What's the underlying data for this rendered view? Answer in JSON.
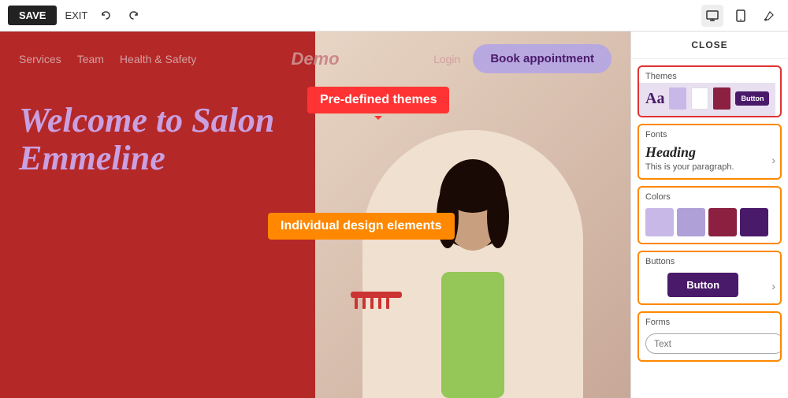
{
  "toolbar": {
    "save_label": "SAVE",
    "exit_label": "EXIT",
    "close_label": "CLOSE"
  },
  "preview": {
    "nav": {
      "links": [
        "Services",
        "Team",
        "Health & Safety"
      ],
      "logo": "Demo",
      "login": "Login",
      "book_btn": "Book appointment"
    },
    "hero_title": "Welcome to Salon Emmeline",
    "tooltip_themes": "Pre-defined themes",
    "tooltip_design": "Individual design elements"
  },
  "right_panel": {
    "close": "CLOSE",
    "sections": [
      {
        "id": "themes",
        "label": "Themes",
        "aa_text": "Aa",
        "btn_preview": "Button",
        "swatches": [
          "#c8b8e8",
          "#fff",
          "#8b2040"
        ]
      },
      {
        "id": "fonts",
        "label": "Fonts",
        "heading": "Heading",
        "paragraph": "This is your paragraph."
      },
      {
        "id": "colors",
        "label": "Colors",
        "swatches": [
          "#c8b8e8",
          "#b0a0d8",
          "#8b2040",
          "#4a1a6a"
        ]
      },
      {
        "id": "buttons",
        "label": "Buttons",
        "btn_label": "Button"
      },
      {
        "id": "forms",
        "label": "Forms",
        "input_placeholder": "Text"
      }
    ]
  },
  "colors": {
    "accent_red": "#b52828",
    "accent_purple": "#b8a8e0",
    "dark_purple": "#4a1a6a",
    "border_red": "#e03333",
    "border_orange": "#ff8800"
  }
}
